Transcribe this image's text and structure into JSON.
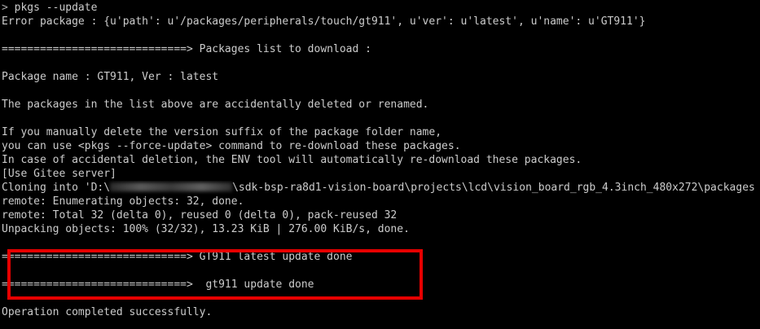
{
  "colors": {
    "background": "#000000",
    "text": "#cccccc",
    "highlight_box": "#e60000"
  },
  "terminal": {
    "prompt_symbol": ">",
    "command": " pkgs --update",
    "error_line": "Error package : {u'path': u'/packages/peripherals/touch/gt911', u'ver': u'latest', u'name': u'GT911'}",
    "list_header": "=============================> Packages list to download :",
    "package_line": "Package name : GT911, Ver : latest",
    "accident_line": "The packages in the list above are accidentally deleted or renamed.",
    "manual_line_1": "If you manually delete the version suffix of the package folder name,",
    "manual_line_2": "you can use <pkgs --force-update> command to re-download these packages.",
    "manual_line_3": "In case of accidental deletion, the ENV tool will automatically re-download these packages.",
    "gitee_line": "[Use Gitee server]",
    "cloning_prefix": "Cloning into 'D:\\",
    "cloning_suffix": "\\sdk-bsp-ra8d1-vision-board\\projects\\lcd\\vision_board_rgb_4.3inch_480x272\\packages",
    "remote_enum": "remote: Enumerating objects: 32, done.",
    "remote_total": "remote: Total 32 (delta 0), reused 0 (delta 0), pack-reused 32",
    "unpacking": "Unpacking objects: 100% (32/32), 13.23 KiB | 276.00 KiB/s, done.",
    "update_done_1": "=============================> GT911 latest update done",
    "update_done_2": "=============================>  gt911 update done",
    "operation_done": "Operation completed successfully."
  }
}
